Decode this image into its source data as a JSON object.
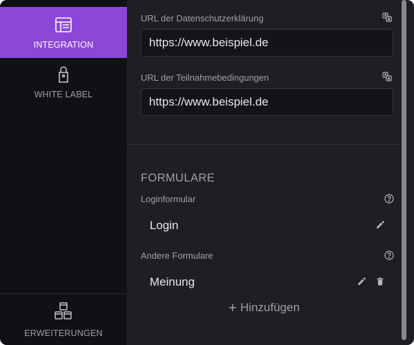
{
  "sidebar": {
    "items": [
      {
        "label": "INTEGRATION",
        "icon": "window-icon",
        "active": true
      },
      {
        "label": "WHITE LABEL",
        "icon": "tag-icon",
        "active": false
      }
    ],
    "bottom": {
      "label": "ERWEITERUNGEN",
      "icon": "cubes-icon"
    }
  },
  "fields": {
    "privacy": {
      "label": "URL der Datenschutzerklärung",
      "value": "https://www.beispiel.de"
    },
    "terms": {
      "label": "URL der Teilnahmebedingungen",
      "value": "https://www.beispiel.de"
    }
  },
  "forms": {
    "title": "FORMULARE",
    "login": {
      "label": "Loginformular",
      "name": "Login"
    },
    "other": {
      "label": "Andere Formulare",
      "items": [
        {
          "name": "Meinung"
        }
      ]
    },
    "add_label": "Hinzufügen"
  },
  "colors": {
    "accent": "#8c47d8",
    "background": "#1f1e25",
    "sidebar": "#111014"
  }
}
